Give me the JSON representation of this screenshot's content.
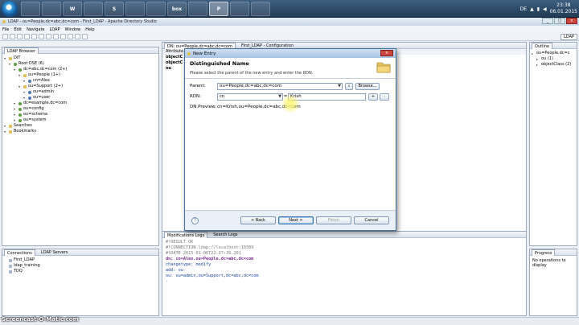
{
  "taskbar": {
    "buttons": [
      {
        "icon": "explorer-icon",
        "label": ""
      },
      {
        "icon": "media-player-icon",
        "label": ""
      },
      {
        "icon": "word-icon",
        "label": "W"
      },
      {
        "icon": "chrome-icon",
        "label": ""
      },
      {
        "icon": "skype-icon",
        "label": "S"
      },
      {
        "icon": "firefox-icon",
        "label": ""
      },
      {
        "icon": "vlc-icon",
        "label": ""
      },
      {
        "icon": "box-icon",
        "label": "box"
      },
      {
        "icon": "app-icon",
        "label": ""
      },
      {
        "icon": "powerpoint-icon",
        "label": "P"
      },
      {
        "icon": "photo-icon",
        "label": ""
      },
      {
        "icon": "terminal-icon",
        "label": ""
      }
    ],
    "language": "DE",
    "time": "23:38",
    "date": "06.01.2015"
  },
  "app": {
    "title": "LDAP - ou=People,dc=abc,dc=com - First_LDAP - Apache Directory Studio",
    "menu": [
      "File",
      "Edit",
      "Navigate",
      "LDAP",
      "Window",
      "Help"
    ],
    "perspective": "LDAP"
  },
  "ldap_browser": {
    "tab": "LDAP Browser",
    "tree": [
      {
        "label": "DIT",
        "depth": 0,
        "icon": "folder"
      },
      {
        "label": "Root DSE (6)",
        "depth": 1,
        "icon": "green"
      },
      {
        "label": "dc=abc,dc=com (2+)",
        "depth": 2,
        "icon": "green"
      },
      {
        "label": "ou=People (1+)",
        "depth": 3,
        "icon": "folder"
      },
      {
        "label": "cn=Alex",
        "depth": 4,
        "icon": "person"
      },
      {
        "label": "ou=Support (2+)",
        "depth": 3,
        "icon": "folder"
      },
      {
        "label": "ou=admin",
        "depth": 4,
        "icon": "person"
      },
      {
        "label": "ou=user",
        "depth": 4,
        "icon": "person"
      },
      {
        "label": "dc=example,dc=com",
        "depth": 2,
        "icon": "green"
      },
      {
        "label": "ou=config",
        "depth": 2,
        "icon": "green"
      },
      {
        "label": "ou=schema",
        "depth": 2,
        "icon": "green"
      },
      {
        "label": "ou=system",
        "depth": 2,
        "icon": "green"
      },
      {
        "label": "Searches",
        "depth": 0,
        "icon": "folder"
      },
      {
        "label": "Bookmarks",
        "depth": 0,
        "icon": "folder"
      }
    ]
  },
  "editor": {
    "tabs": [
      "DN: ou=People,dc=abc,dc=com",
      "First_LDAP - Configuration"
    ],
    "col_header": "Attribute",
    "rows": [
      "objectC",
      "objectC",
      "ou"
    ]
  },
  "outline": {
    "tab": "Outline",
    "items": [
      "ou=People,dc=c",
      "ou (1)",
      "objectClass (2)"
    ]
  },
  "connections": {
    "tabs": [
      "Connections",
      "LDAP Servers"
    ],
    "items": [
      "First_LDAP",
      "ldap_training",
      "TDQ"
    ]
  },
  "logs": {
    "tabs": [
      "Modifications Logs",
      "Search Logs"
    ],
    "lines": [
      {
        "t": "c",
        "text": "#!RESULT OK"
      },
      {
        "t": "c",
        "text": "#!CONNECTION ldap://localhost:10389"
      },
      {
        "t": "c",
        "text": "#!DATE 2015-01-06T22:37:39.201"
      },
      {
        "t": "k",
        "text": "dn: cn=Alex,ou=People,dc=abc,dc=com"
      },
      {
        "t": "v",
        "text": "changetype: modify"
      },
      {
        "t": "v",
        "text": "add: ou"
      },
      {
        "t": "v",
        "text": "ou: ou=admin,ou=Support,dc=abc,dc=com"
      },
      {
        "t": "v",
        "text": "-"
      }
    ]
  },
  "progress": {
    "tab": "Progress",
    "message": "No operations to display"
  },
  "dialog": {
    "title": "New Entry",
    "heading": "Distinguished Name",
    "description": "Please select the parent of the new entry and enter the RDN.",
    "parent_label": "Parent:",
    "parent_value": "ou=People,dc=abc,dc=com",
    "browse_label": "Browse...",
    "rdn_label": "RDN:",
    "rdn_attr": "cn",
    "rdn_equals": "=",
    "rdn_value": "Krish",
    "plus_label": "+",
    "minus_label": "-",
    "preview_label": "DN Preview:",
    "preview_value": "cn=Krish,ou=People,dc=abc,dc=com",
    "help_label": "?",
    "back_label": "< Back",
    "next_label": "Next >",
    "finish_label": "Finish",
    "cancel_label": "Cancel"
  },
  "watermark": "Screencast-O-Matic.com"
}
